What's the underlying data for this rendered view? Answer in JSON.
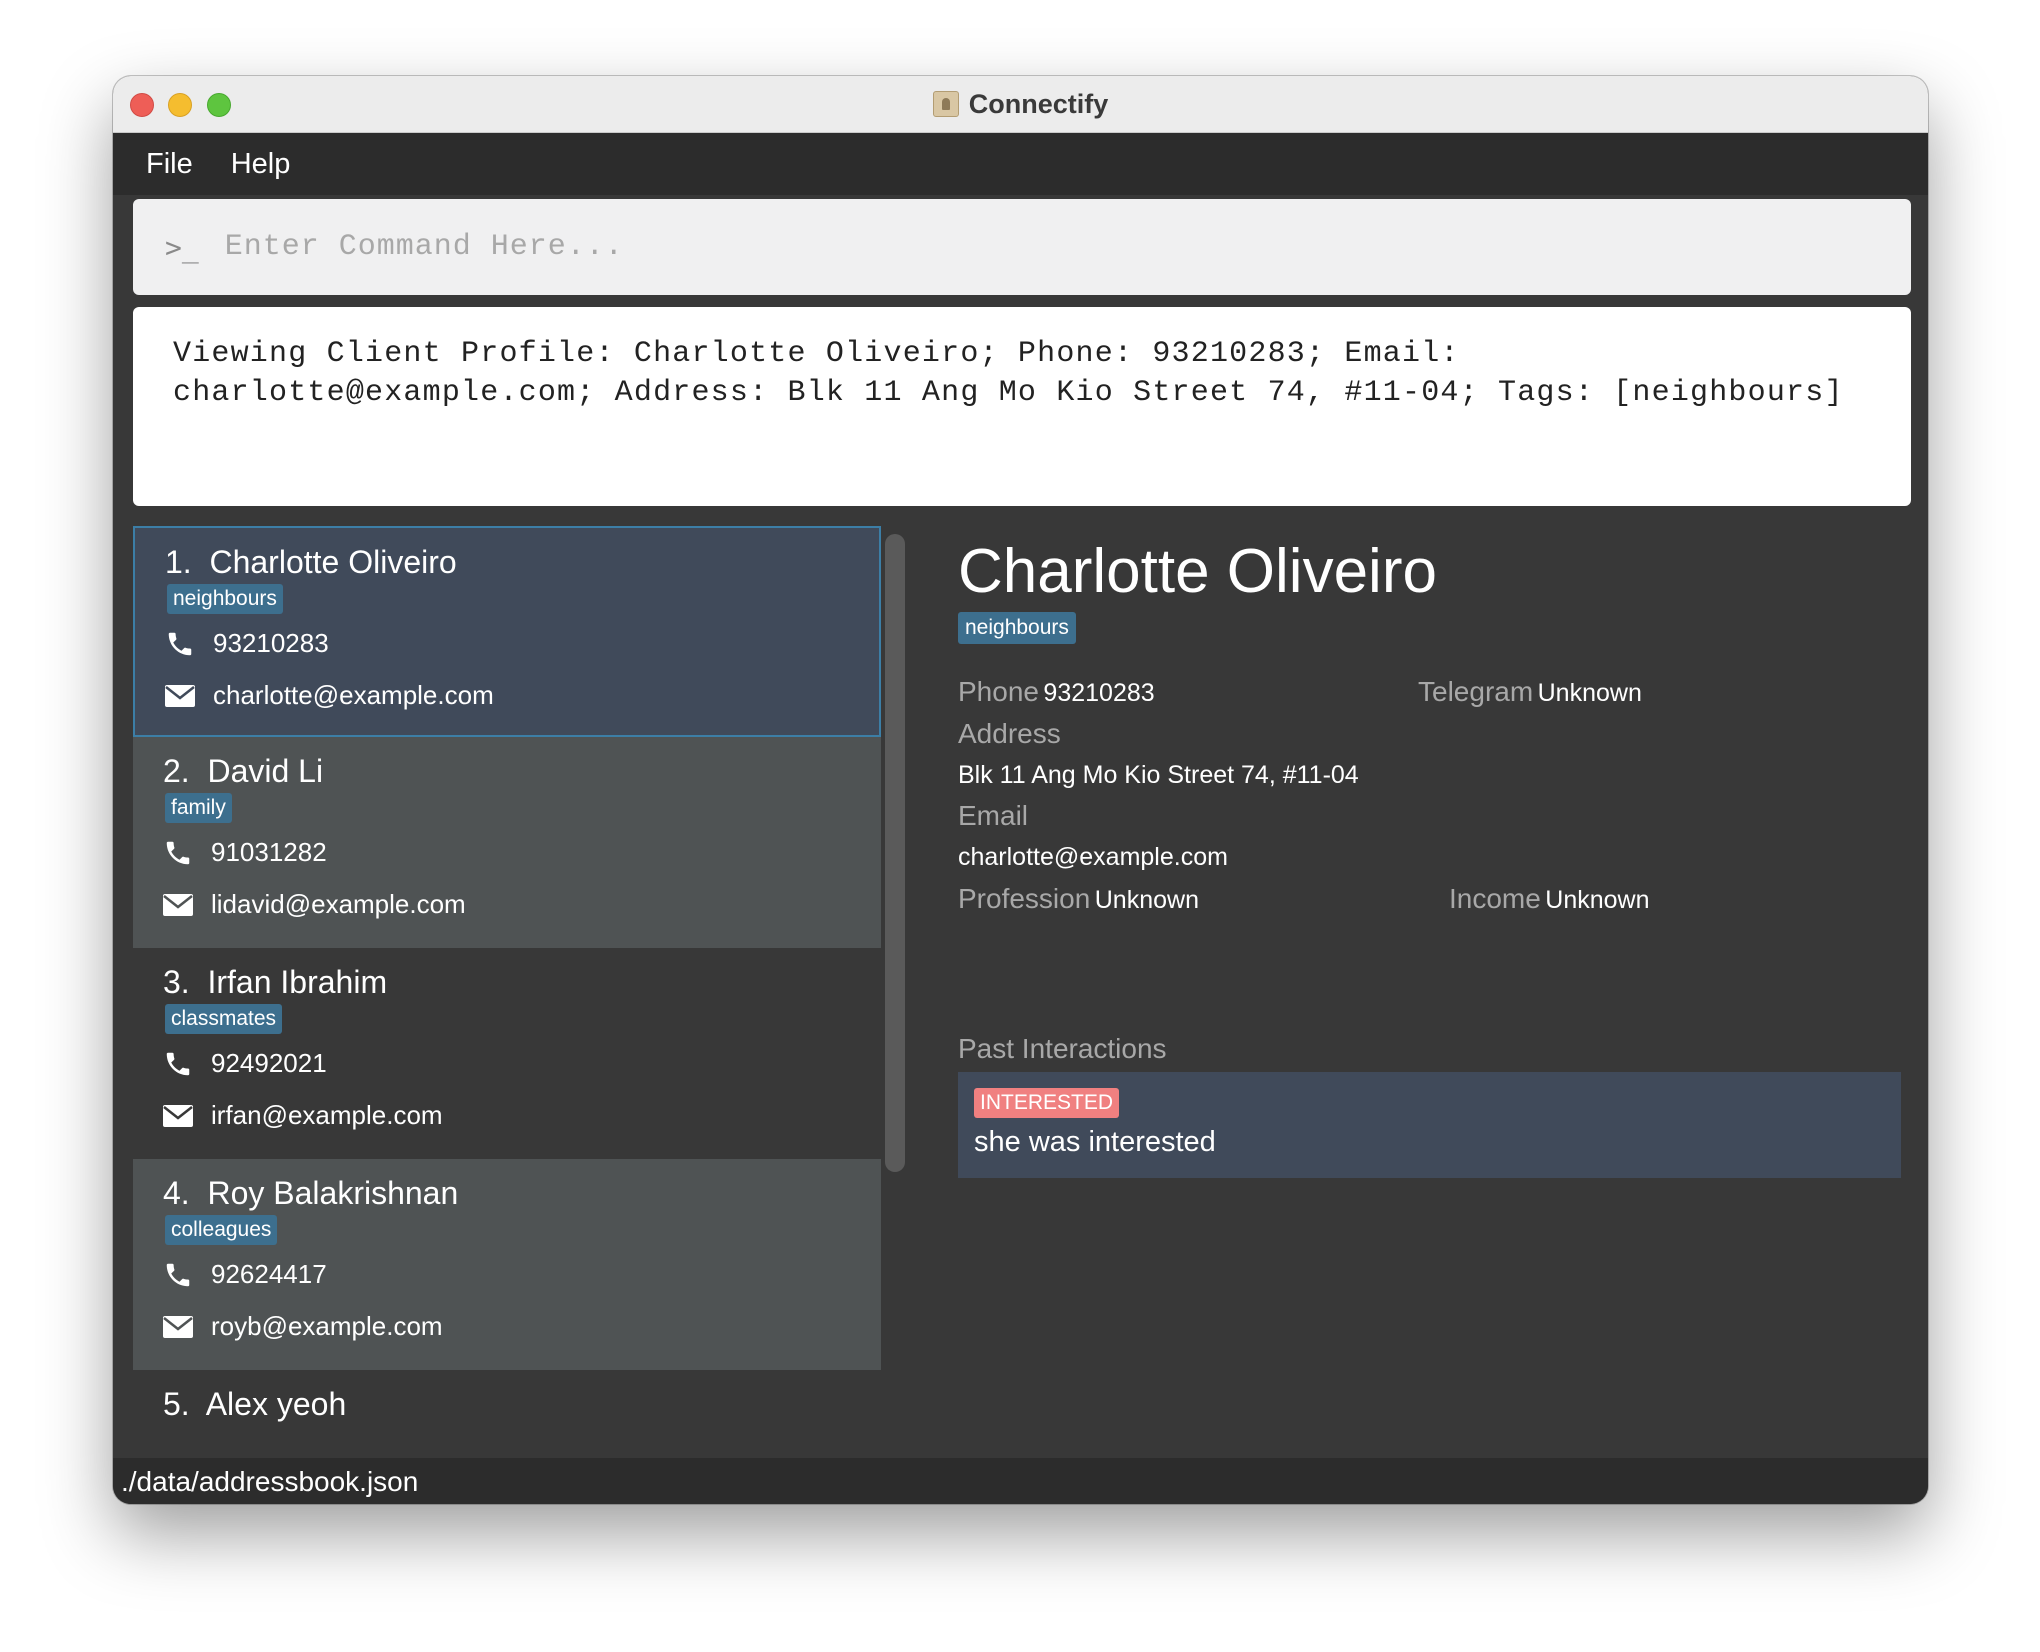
{
  "window": {
    "title": "Connectify"
  },
  "menu": {
    "items": [
      "File",
      "Help"
    ]
  },
  "command": {
    "placeholder": "Enter Command Here...",
    "prompt_icon": "terminal-prompt-icon"
  },
  "result": {
    "text": "Viewing Client Profile: Charlotte Oliveiro; Phone: 93210283; Email:\ncharlotte@example.com; Address: Blk 11 Ang Mo Kio Street 74, #11-04; Tags: [neighbours]"
  },
  "clients": [
    {
      "index": "1.",
      "name": "Charlotte Oliveiro",
      "tag": "neighbours",
      "phone": "93210283",
      "email": "charlotte@example.com"
    },
    {
      "index": "2.",
      "name": "David Li",
      "tag": "family",
      "phone": "91031282",
      "email": "lidavid@example.com"
    },
    {
      "index": "3.",
      "name": "Irfan Ibrahim",
      "tag": "classmates",
      "phone": "92492021",
      "email": "irfan@example.com"
    },
    {
      "index": "4.",
      "name": "Roy Balakrishnan",
      "tag": "colleagues",
      "phone": "92624417",
      "email": "royb@example.com"
    },
    {
      "index": "5.",
      "name": "Alex yeoh"
    }
  ],
  "detail": {
    "name": "Charlotte Oliveiro",
    "tag": "neighbours",
    "phone_label": "Phone",
    "phone": "93210283",
    "telegram_label": "Telegram",
    "telegram": "Unknown",
    "address_label": "Address",
    "address": "Blk 11 Ang Mo Kio Street 74, #11-04",
    "email_label": "Email",
    "email": "charlotte@example.com",
    "profession_label": "Profession",
    "profession": "Unknown",
    "income_label": "Income",
    "income": "Unknown",
    "interactions_label": "Past Interactions",
    "interactions": [
      {
        "status": "INTERESTED",
        "note": "she was interested"
      }
    ]
  },
  "statusbar": {
    "path": "./data/addressbook.json"
  },
  "colors": {
    "tag": "#3d6f8e",
    "selected_card": "#404a5a",
    "selected_border": "#3c7ea6",
    "interested": "#f08080"
  }
}
